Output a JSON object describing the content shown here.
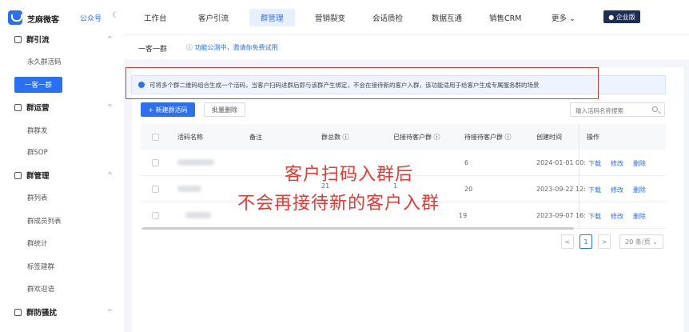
{
  "brand": {
    "name": "芝麻微客",
    "sub_link": "公众号"
  },
  "nav": {
    "items": [
      "工作台",
      "客户引流",
      "群管理",
      "营销裂变",
      "会话质检",
      "数据互通",
      "销售CRM",
      "更多 ⌄"
    ],
    "active_index": 2,
    "enterprise_badge": "● 企业版"
  },
  "sidebar": {
    "groups": [
      {
        "label": "群引流",
        "items": [
          "永久群活码",
          "一客一群"
        ]
      },
      {
        "label": "群运营",
        "items": [
          "群群发",
          "群SOP"
        ]
      },
      {
        "label": "群管理",
        "items": [
          "群列表",
          "群成员列表",
          "群统计",
          "标签建群",
          "群欢迎语"
        ]
      },
      {
        "label": "群防骚扰",
        "items": []
      }
    ],
    "active_item": "一客一群"
  },
  "page": {
    "title": "一客一群",
    "beta_note": "ⓘ 功能公测中，邀请你免费试用",
    "notice": "可将多个群二维码组合生成一个活码，当客户扫码进群后即与该群产生绑定，不会在接待新的客户入群，该功能适用于给客户生成专属服务群的场景"
  },
  "toolbar": {
    "new_label": "+ 新建群活码",
    "batch_delete_label": "批量删除",
    "search_placeholder": "输入活码名称搜索"
  },
  "table": {
    "headers": [
      "活码名称",
      "备注",
      "群总数 ⓘ",
      "已接待客户群 ⓘ",
      "待接待客户群 ⓘ",
      "创建时间",
      "操作"
    ],
    "rows": [
      {
        "total": "",
        "received": "",
        "pending": "6",
        "created": "2024-01-01 00:",
        "actions": [
          "下载",
          "修改",
          "删除"
        ]
      },
      {
        "total": "21",
        "received": "1",
        "pending": "20",
        "created": "2023-09-22 12:",
        "actions": [
          "下载",
          "修改",
          "删除"
        ]
      },
      {
        "total": "",
        "received": "",
        "pending": "19",
        "created": "2023-09-07 16:",
        "actions": [
          "下载",
          "修改",
          "删除"
        ]
      }
    ]
  },
  "pagination": {
    "prev": "<",
    "current": "1",
    "next": ">",
    "page_size": "20 条/页 ⌄"
  },
  "overlay": {
    "line1": "客户扫码入群后",
    "line2": "不会再接待新的客户入群"
  },
  "colors": {
    "accent": "#2b6ff2",
    "annotation_red": "#e03c36"
  }
}
